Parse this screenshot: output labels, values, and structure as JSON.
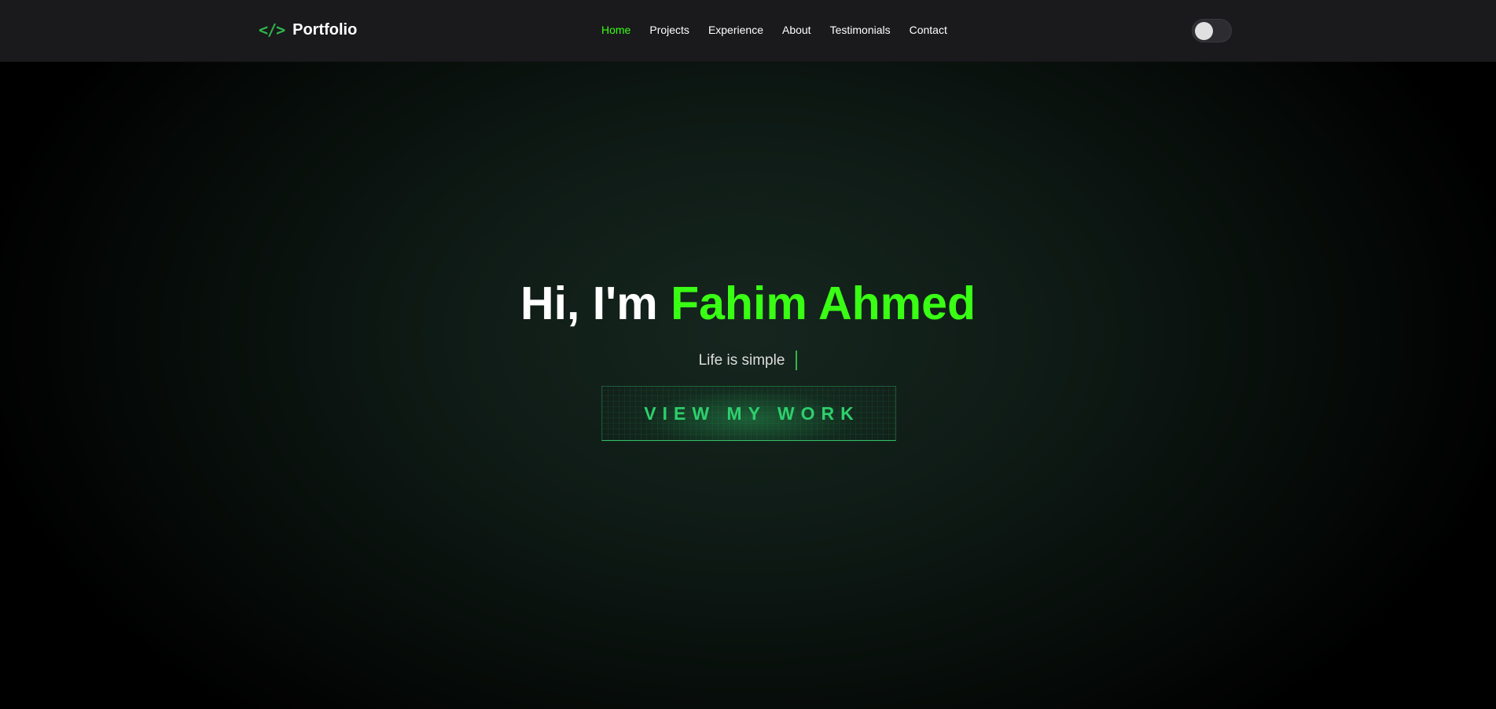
{
  "navbar": {
    "brand": {
      "icon": "</>",
      "icon_name": "code-icon",
      "title": "Portfolio"
    },
    "links": [
      {
        "label": "Home",
        "active": true
      },
      {
        "label": "Projects",
        "active": false
      },
      {
        "label": "Experience",
        "active": false
      },
      {
        "label": "About",
        "active": false
      },
      {
        "label": "Testimonials",
        "active": false
      },
      {
        "label": "Contact",
        "active": false
      }
    ],
    "theme_toggle": {
      "on": false
    }
  },
  "hero": {
    "greeting": "Hi, I'm",
    "name": "Fahim Ahmed",
    "tagline": "Life is simple",
    "cta_label": "VIEW MY WORK"
  },
  "colors": {
    "accent": "#39ff14",
    "accent_dark": "#2fb84a",
    "cta_text": "#2ecf6d",
    "navbar_bg": "#1a1a1d",
    "page_bg": "#000000"
  }
}
